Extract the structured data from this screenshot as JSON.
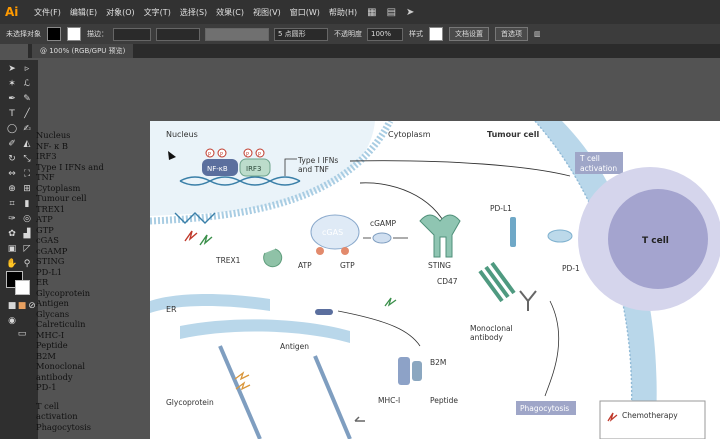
{
  "app": {
    "logo": "Ai"
  },
  "menu": [
    "文件(F)",
    "编辑(E)",
    "对象(O)",
    "文字(T)",
    "选择(S)",
    "效果(C)",
    "视图(V)",
    "窗口(W)",
    "帮助(H)"
  ],
  "control_bar": {
    "selection": "未选择对象",
    "stroke_label": "描边：",
    "point_label": "5 点圆形",
    "opacity_label": "不透明度",
    "opacity_value": "100%",
    "style_label": "样式",
    "doc_setup": "文档设置",
    "preferences": "首选项"
  },
  "tab": {
    "title": "@ 100% (RGB/GPU 预览)"
  },
  "layers_text": [
    "Nucleus",
    "NF- κ B",
    "IRF3",
    "Type I IFNs and TNF",
    "Cytoplasm",
    "Tumour cell",
    "TREX1",
    "ATP",
    "GTP",
    "cGAS",
    "cGAMP",
    "STING",
    "PD-L1",
    "ER",
    "Glycoprotein",
    "Antigen",
    "Glycans",
    "Calreticulin",
    "MHC-I",
    "Peptide",
    "B2M",
    "Monoclonal",
    "antibody",
    "PD-1",
    "T cell",
    "activation",
    "Phagocytosis"
  ],
  "diagram": {
    "nucleus": "Nucleus",
    "cytoplasm": "Cytoplasm",
    "tumour_cell": "Tumour cell",
    "nfkb": "NF-κB",
    "irf3": "IRF3",
    "p": "P",
    "type1_line1": "Type I IFNs",
    "type1_line2": "and TNF",
    "cgas": "cGAS",
    "cgamp": "cGAMP",
    "atp": "ATP",
    "gtp": "GTP",
    "trex1": "TREX1",
    "sting": "STING",
    "pdl1": "PD-L1",
    "tcell_act_line1": "T cell",
    "tcell_act_line2": "activation",
    "tcell": "T cell",
    "pd1": "PD-1",
    "cd47": "CD47",
    "er": "ER",
    "antigen": "Antigen",
    "b2m": "B2M",
    "mhc": "MHC-I",
    "peptide": "Peptide",
    "mono_line1": "Monoclonal",
    "mono_line2": "antibody",
    "phagocytosis": "Phagocytosis",
    "glycoprotein": "Glycoprotein",
    "chemotherapy": "Chemotherapy"
  },
  "colors": {
    "accent": "#ff9a00",
    "membrane": "#b9d7ea",
    "tcell": "#c9c9e8"
  }
}
